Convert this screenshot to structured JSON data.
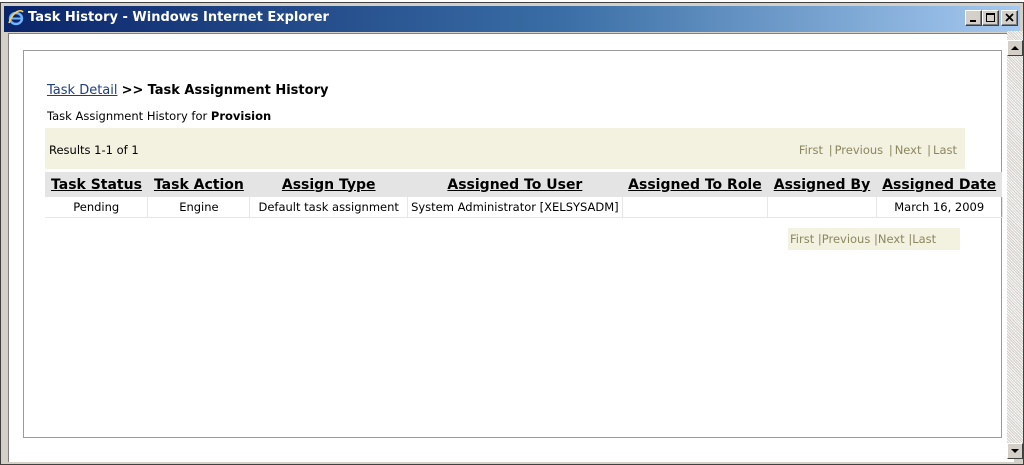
{
  "window": {
    "title": "Task History - Windows Internet Explorer",
    "controls": {
      "minimize": "minimize",
      "maximize": "maximize",
      "close": "close"
    }
  },
  "breadcrumb": {
    "link": "Task Detail",
    "separator": ">>",
    "current": "Task Assignment History"
  },
  "subtitle": {
    "prefix": "Task Assignment History for",
    "task_name": "Provision"
  },
  "results": {
    "count_text": "Results 1-1 of 1"
  },
  "pager": {
    "first": "First",
    "previous": "Previous",
    "next": "Next",
    "last": "Last",
    "sep": "|"
  },
  "table": {
    "headers": [
      "Task Status",
      "Task Action",
      "Assign Type",
      "Assigned To User",
      "Assigned To Role",
      "Assigned By",
      "Assigned Date"
    ],
    "rows": [
      [
        "Pending",
        "Engine",
        "Default task assignment",
        "System Administrator [XELSYSADM]",
        "",
        "",
        "March 16, 2009"
      ]
    ]
  },
  "colors": {
    "titlebar_start": "#0a246a",
    "titlebar_end": "#a6caf0",
    "results_bar": "#f3f1df",
    "pager_text": "#8b8760",
    "link": "#1f3f7f",
    "header_bg": "#e4e4e4"
  },
  "icons": {
    "browser": "ie-logo-icon",
    "scroll_up": "arrow-up-icon",
    "scroll_down": "arrow-down-icon"
  }
}
